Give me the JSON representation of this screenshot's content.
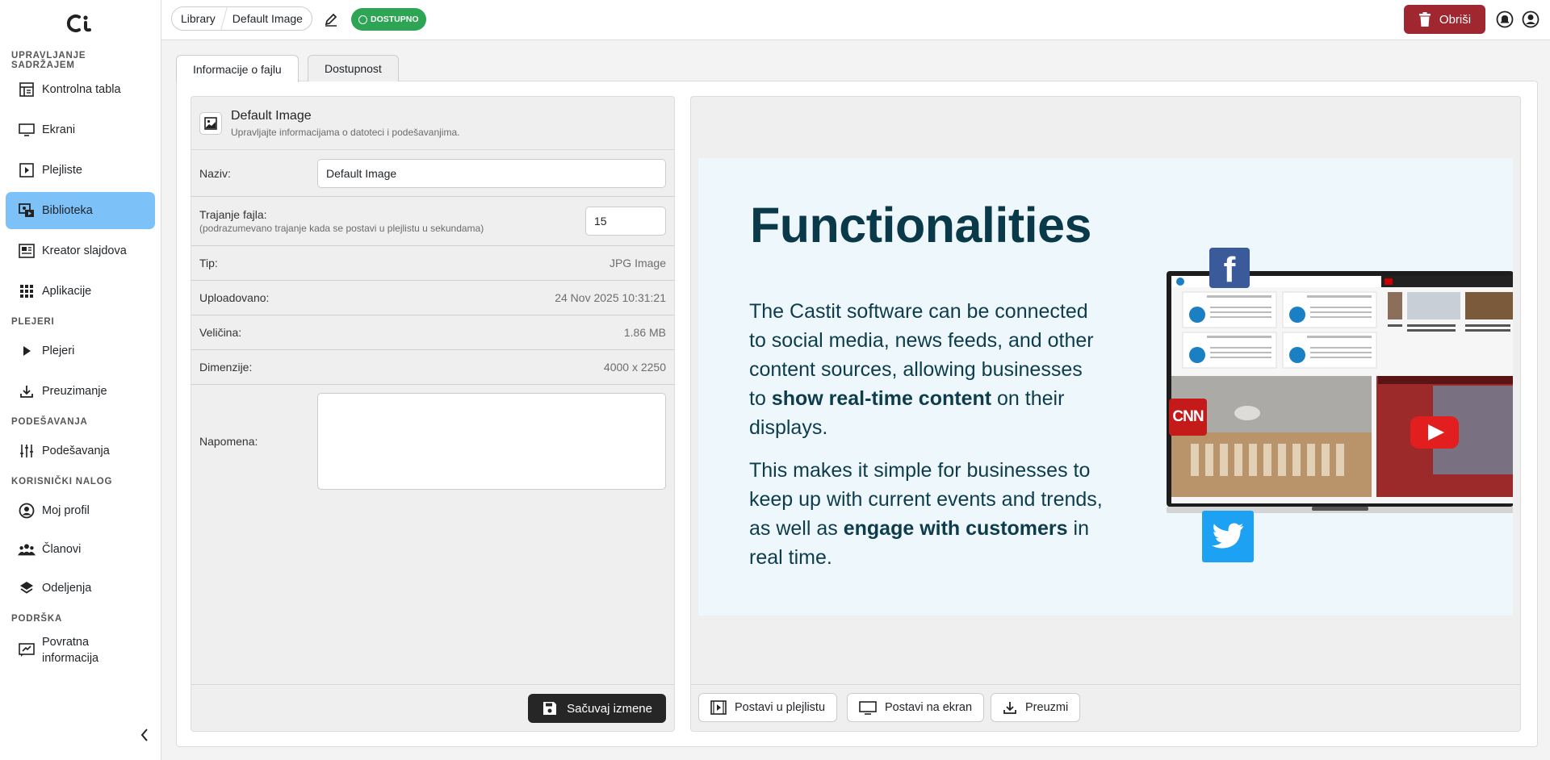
{
  "sidebar": {
    "sections": [
      {
        "title": "UPRAVLJANJE SADRŽAJEM"
      },
      {
        "title": "PLEJERI"
      },
      {
        "title": "PODEŠAVANJA"
      },
      {
        "title": "KORISNIČKI NALOG"
      },
      {
        "title": "PODRŠKA"
      }
    ],
    "items": [
      {
        "label": "Kontrolna tabla",
        "icon": "dashboard-icon"
      },
      {
        "label": "Ekrani",
        "icon": "monitor-icon"
      },
      {
        "label": "Plejliste",
        "icon": "playlist-icon"
      },
      {
        "label": "Biblioteka",
        "icon": "library-icon",
        "active": true
      },
      {
        "label": "Kreator slajdova",
        "icon": "slide-creator-icon"
      },
      {
        "label": "Aplikacije",
        "icon": "apps-grid-icon"
      },
      {
        "label": "Plejeri",
        "icon": "play-icon"
      },
      {
        "label": "Preuzimanje",
        "icon": "download-icon"
      },
      {
        "label": "Podešavanja",
        "icon": "sliders-icon"
      },
      {
        "label": "Moj profil",
        "icon": "profile-icon"
      },
      {
        "label": "Članovi",
        "icon": "members-icon"
      },
      {
        "label": "Odeljenja",
        "icon": "layers-icon"
      },
      {
        "label": "Povratna informacija",
        "icon": "feedback-icon"
      }
    ]
  },
  "topbar": {
    "breadcrumb": [
      "Library",
      "Default Image"
    ],
    "status": "DOSTUPNO",
    "delete_label": "Obriši",
    "status_color": "#2da554",
    "delete_color": "#a0262f"
  },
  "tabs": [
    "Informacije o fajlu",
    "Dostupnost"
  ],
  "file_info": {
    "title": "Default Image",
    "subtitle": "Upravljajte informacijama o datoteci i podešavanjima.",
    "name_label": "Naziv:",
    "name_value": "Default Image",
    "duration_label": "Trajanje fajla:",
    "duration_hint": "(podrazumevano trajanje kada se postavi u plejlistu u sekundama)",
    "duration_value": "15",
    "type_label": "Tip:",
    "type_value": "JPG Image",
    "uploaded_label": "Uploadovano:",
    "uploaded_value": "24 Nov 2025 10:31:21",
    "size_label": "Veličina:",
    "size_value": "1.86 MB",
    "dimensions_label": "Dimenzije:",
    "dimensions_value": "4000 x 2250",
    "note_label": "Napomena:",
    "note_value": "",
    "save_label": "Sačuvaj izmene"
  },
  "preview": {
    "slide": {
      "title": "Functionalities",
      "p1_a": "The Castit software can be connected to social media, news feeds, and other content sources, allowing businesses to ",
      "p1_b": "show real-time content",
      "p1_c": " on their displays.",
      "p2_a": "This makes it simple for businesses to keep up with current events and trends, as well as ",
      "p2_b": "engage with customers",
      "p2_c": " in real time.",
      "cnn": "CNN"
    },
    "actions": {
      "playlist": "Postavi u plejlistu",
      "screen": "Postavi na ekran",
      "download": "Preuzmi"
    }
  }
}
